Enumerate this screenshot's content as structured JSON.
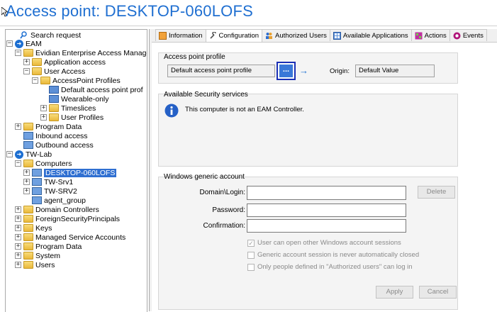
{
  "window": {
    "title": "Access point: DESKTOP-060LOFS"
  },
  "tree": {
    "items": [
      {
        "label": "Search request",
        "icon": "search-icon"
      },
      {
        "label": "EAM",
        "icon": "eam-icon"
      },
      {
        "label": "Evidian Enterprise Access Managem",
        "icon": "folder-icon"
      },
      {
        "label": "Application access",
        "icon": "folder-icon"
      },
      {
        "label": "User Access",
        "icon": "folder-icon"
      },
      {
        "label": "AccessPoint Profiles",
        "icon": "folder-icon"
      },
      {
        "label": "Default access point prof",
        "icon": "profile-icon"
      },
      {
        "label": "Wearable-only",
        "icon": "profile-icon"
      },
      {
        "label": "Timeslices",
        "icon": "folder-icon"
      },
      {
        "label": "User Profiles",
        "icon": "folder-icon"
      },
      {
        "label": "Program Data",
        "icon": "folder-icon"
      },
      {
        "label": "Inbound access",
        "icon": "access-icon"
      },
      {
        "label": "Outbound access",
        "icon": "access-icon"
      },
      {
        "label": "TW-Lab",
        "icon": "domain-icon"
      },
      {
        "label": "Computers",
        "icon": "folder-icon"
      },
      {
        "label": "DESKTOP-060LOFS",
        "icon": "computer-icon"
      },
      {
        "label": "TW-Srv1",
        "icon": "computer-icon"
      },
      {
        "label": "TW-SRV2",
        "icon": "computer-icon"
      },
      {
        "label": "agent_group",
        "icon": "group-icon"
      },
      {
        "label": "Domain Controllers",
        "icon": "folder-icon"
      },
      {
        "label": "ForeignSecurityPrincipals",
        "icon": "folder-icon"
      },
      {
        "label": "Keys",
        "icon": "folder-icon"
      },
      {
        "label": "Managed Service Accounts",
        "icon": "folder-icon"
      },
      {
        "label": "Program Data",
        "icon": "folder-icon"
      },
      {
        "label": "System",
        "icon": "folder-icon"
      },
      {
        "label": "Users",
        "icon": "folder-icon"
      }
    ]
  },
  "tabs": [
    {
      "label": "Information",
      "icon": "info-tab-icon"
    },
    {
      "label": "Configuration",
      "icon": "wrench-icon"
    },
    {
      "label": "Authorized Users",
      "icon": "users-icon"
    },
    {
      "label": "Available Applications",
      "icon": "apps-icon"
    },
    {
      "label": "Actions",
      "icon": "actions-icon"
    },
    {
      "label": "Events",
      "icon": "events-icon"
    }
  ],
  "profile": {
    "group_label": "Access point profile",
    "value": "Default access point profile",
    "browse_label": "...",
    "arrow": "→",
    "origin_label": "Origin:",
    "origin_value": "Default Value"
  },
  "security": {
    "group_label": "Available Security services",
    "message": "This computer is not an EAM Controller."
  },
  "account": {
    "group_label": "Windows generic account",
    "domain_label": "Domain\\Login:",
    "password_label": "Password:",
    "confirmation_label": "Confirmation:",
    "delete_label": "Delete",
    "checkbox1": "User can open other Windows account sessions",
    "checkbox2": "Generic account session is never automatically closed",
    "checkbox3": "Only people defined in \"Authorized users\" can log in",
    "apply_label": "Apply",
    "cancel_label": "Cancel"
  },
  "colors": {
    "title": "#1f6fd1",
    "selection": "#2f6fd1",
    "highlight_border": "#1a2fb5"
  }
}
